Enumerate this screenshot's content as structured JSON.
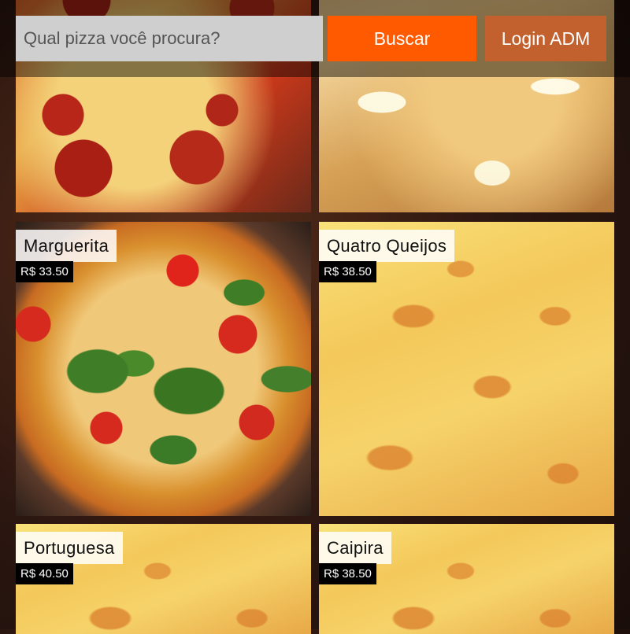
{
  "search": {
    "placeholder": "Qual pizza você procura?",
    "button_label": "Buscar"
  },
  "header": {
    "login_label": "Login ADM"
  },
  "pizzas": [
    {
      "name": "",
      "price": ""
    },
    {
      "name": "",
      "price": ""
    },
    {
      "name": "Marguerita",
      "price": "R$ 33.50"
    },
    {
      "name": "Quatro Queijos",
      "price": "R$ 38.50"
    },
    {
      "name": "Portuguesa",
      "price": "R$ 40.50"
    },
    {
      "name": "Caipira",
      "price": "R$ 38.50"
    }
  ],
  "colors": {
    "search_button": "#ff5a00",
    "login_button": "#c2612e",
    "search_field": "#cfcfcf",
    "price_tag_bg": "#000000"
  }
}
